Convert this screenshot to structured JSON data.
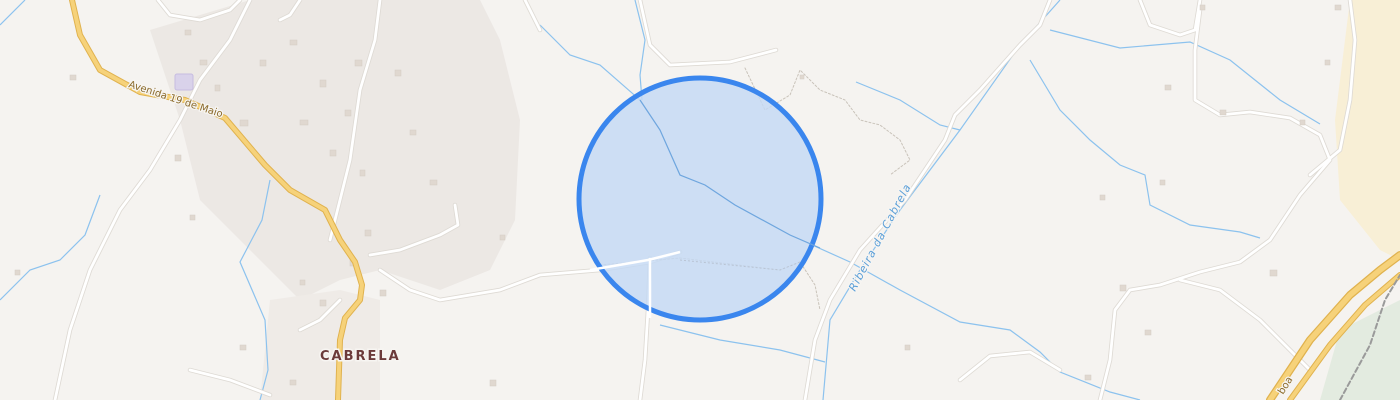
{
  "map": {
    "place_name": "CABRELA",
    "road_name": "Avenida 19 de Maio",
    "river_name": "Ribeira da Cabrela",
    "partial_road_name": "boa"
  },
  "colors": {
    "background": "#f5f3f0",
    "settlement_area": "#ece8e4",
    "major_road": "#f6d27a",
    "major_road_casing": "#e0b24e",
    "minor_road": "#ffffff",
    "minor_road_casing": "#dedad4",
    "waterway": "#8cc2ee",
    "highlight_fill": "#c5d9f4",
    "highlight_stroke": "#3a86ee",
    "building": "#e6dfd8",
    "railway": "#9a9a9a",
    "sand_area": "#f8efd6"
  }
}
